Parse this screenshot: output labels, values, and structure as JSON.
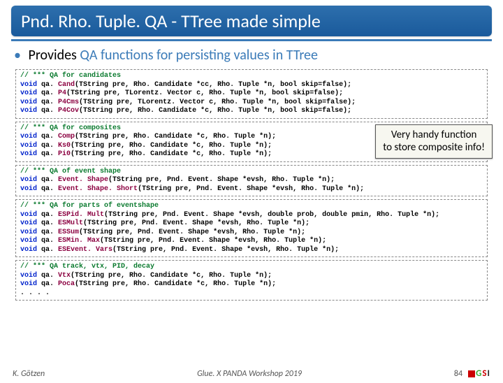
{
  "title": "Pnd. Rho. Tuple. QA - TTree made simple",
  "bullet": {
    "lead": "Provides",
    "rest": "QA functions for persisting values in TTree"
  },
  "blocks": [
    {
      "comment": "// *** QA for candidates",
      "lines": [
        "void qa. Cand(TString pre, Rho. Candidate *cc, Rho. Tuple *n, bool skip=false);",
        "void qa. P4(TString pre, TLorentz. Vector c, Rho. Tuple *n, bool skip=false);",
        "void qa. P4Cms(TString pre, TLorentz. Vector c, Rho. Tuple *n, bool skip=false);",
        "void qa. P4Cov(TString pre, Rho. Candidate *c, Rho. Tuple *n, bool skip=false);"
      ],
      "fns": [
        "Cand",
        "P4",
        "P4Cms",
        "P4Cov"
      ]
    },
    {
      "comment": "// *** QA for composites",
      "lines": [
        "void qa. Comp(TString pre, Rho. Candidate *c, Rho. Tuple *n);",
        "void qa. Ks0(TString pre, Rho. Candidate *c, Rho. Tuple *n);",
        "void qa. Pi0(TString pre, Rho. Candidate *c, Rho. Tuple *n);"
      ],
      "fns": [
        "Comp",
        "Ks0",
        "Pi0"
      ],
      "callout": [
        "Very handy function",
        "to store composite info!"
      ]
    },
    {
      "comment": "// *** QA of event shape",
      "lines": [
        "void qa. Event. Shape(TString pre, Pnd. Event. Shape *evsh, Rho. Tuple *n);",
        "void qa. Event. Shape. Short(TString pre, Pnd. Event. Shape *evsh, Rho. Tuple *n);"
      ],
      "fns": [
        "Event. Shape",
        "Event. Shape. Short"
      ]
    },
    {
      "comment": "// *** QA for parts of eventshape",
      "lines": [
        "void qa. ESPid. Mult(TString pre, Pnd. Event. Shape *evsh, double prob, double pmin, Rho. Tuple *n);",
        "void qa. ESMult(TString pre, Pnd. Event. Shape *evsh, Rho. Tuple *n);",
        "void qa. ESSum(TString pre, Pnd. Event. Shape *evsh, Rho. Tuple *n);",
        "void qa. ESMin. Max(TString pre, Pnd. Event. Shape *evsh, Rho. Tuple *n);",
        "void qa. ESEvent. Vars(TString pre, Pnd. Event. Shape *evsh, Rho. Tuple *n);"
      ],
      "fns": [
        "ESPid. Mult",
        "ESMult",
        "ESSum",
        "ESMin. Max",
        "ESEvent. Vars"
      ]
    },
    {
      "comment": "// *** QA track, vtx, PID, decay",
      "lines": [
        "void qa. Vtx(TString pre, Rho. Candidate *c, Rho. Tuple *n);",
        "void qa. Poca(TString pre, Rho. Candidate *c, Rho. Tuple *n);",
        ". . . ."
      ],
      "fns": [
        "Vtx",
        "Poca",
        ""
      ]
    }
  ],
  "footer": {
    "author": "K. Götzen",
    "center": "Glue. X PANDA Workshop 2019",
    "page": "84",
    "logo": [
      "G",
      "S",
      "I"
    ]
  }
}
